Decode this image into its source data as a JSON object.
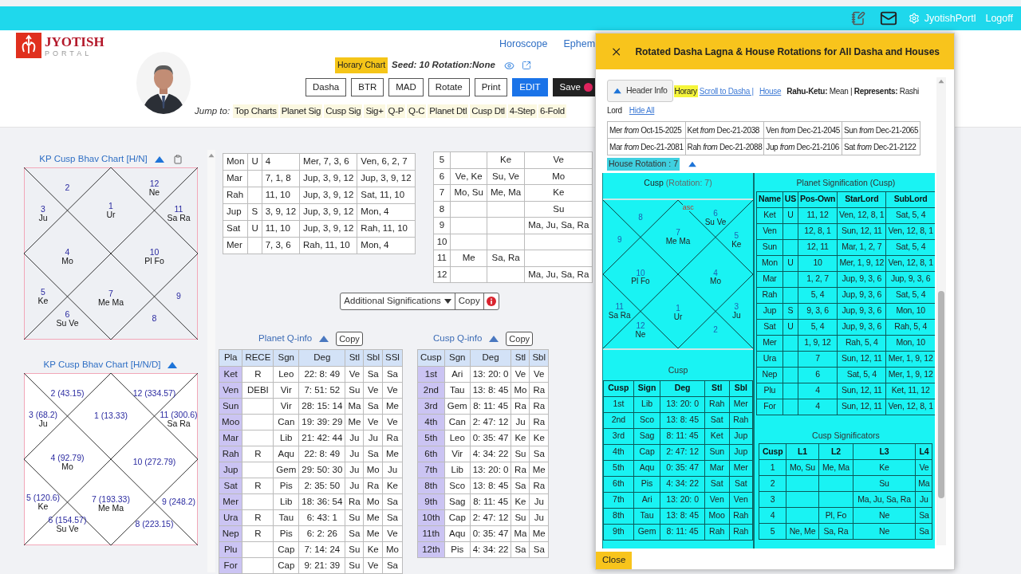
{
  "top_bar": {
    "user": "JyotishPortl",
    "logoff": "Logoff"
  },
  "logo": {
    "title": "JYOTISH",
    "subtitle": "PORTAL"
  },
  "nav": [
    "Horoscope",
    "Ephem"
  ],
  "chart_info": {
    "badge": "Horary Chart",
    "seed": "Seed: 10 Rotation:None"
  },
  "buttons": [
    {
      "label": "Dasha",
      "kind": "plain"
    },
    {
      "label": "BTR",
      "kind": "plain"
    },
    {
      "label": "MAD",
      "kind": "plain"
    },
    {
      "label": "Rotate",
      "kind": "plain"
    },
    {
      "label": "Print",
      "kind": "plain"
    },
    {
      "label": "EDIT",
      "kind": "primary"
    },
    {
      "label": "Save",
      "kind": "dark"
    }
  ],
  "jump": {
    "label": "Jump to:",
    "links": [
      "Top Charts",
      "Planet Sig",
      "Cusp Sig",
      "Sig+",
      "Q-P",
      "Q-C",
      "Planet Dtl",
      "Cusp Dtl",
      "4-Step",
      "6-Fold"
    ]
  },
  "charts": [
    {
      "title": "KP Cusp Bhav Chart [H/N]",
      "copy_icon": true,
      "shaded": true,
      "houses": [
        {
          "number": "1",
          "planets": "Ur"
        },
        {
          "number": "2"
        },
        {
          "number": "3",
          "planets": "Ju"
        },
        {
          "number": "4",
          "planets": "Mo"
        },
        {
          "number": "5",
          "planets": "Ke"
        },
        {
          "number": "6",
          "planets": "Su Ve"
        },
        {
          "number": "7",
          "planets": "Me Ma"
        },
        {
          "number": "8"
        },
        {
          "number": "9"
        },
        {
          "number": "10",
          "planets": "Pl Fo"
        },
        {
          "number": "11",
          "planets": "Sa Ra"
        },
        {
          "number": "12",
          "planets": "Ne"
        }
      ]
    },
    {
      "title": "KP Cusp Bhav Chart [H/N/D]",
      "copy_icon": false,
      "shaded": false,
      "houses": [
        {
          "number": "1 (13.33)"
        },
        {
          "number": "2 (43.15)"
        },
        {
          "number": "3 (68.2)",
          "planets": "Ju"
        },
        {
          "number": "4 (92.79)",
          "planets": "Mo"
        },
        {
          "number": "5 (120.6)",
          "planets": "Ke"
        },
        {
          "number": "6 (154.57)",
          "planets": "Su Ve"
        },
        {
          "number": "7 (193.33)",
          "planets": "Me Ma"
        },
        {
          "number": "8 (223.15)"
        },
        {
          "number": "9 (248.2)"
        },
        {
          "number": "10 (272.79)"
        },
        {
          "number": "11 (300.6)",
          "planets": "Sa Ra"
        },
        {
          "number": "12 (334.57)"
        }
      ]
    }
  ],
  "planet_table": {
    "rows": [
      [
        "Mon",
        "U",
        "4",
        "Mer, 7, 3, 6",
        "Ven, 6, 2, 7"
      ],
      [
        "Mar",
        null,
        "7, 1, 8",
        "Jup, 3, 9, 12",
        "Jup, 3, 9, 12"
      ],
      [
        "Rah",
        null,
        "11, 10",
        "Jup, 3, 9, 12",
        "Sat, 11, 10"
      ],
      [
        "Jup",
        "S",
        "3, 9, 12",
        "Jup, 3, 9, 12",
        "Mon, 4"
      ],
      [
        "Sat",
        "U",
        "11, 10",
        "Jup, 3, 9, 12",
        "Rah, 11, 10"
      ],
      [
        "Mer",
        null,
        "7, 3, 6",
        "Rah, 11, 10",
        "Mon, 4"
      ]
    ]
  },
  "cusp_table": {
    "rows": [
      [
        "5",
        null,
        "Ke",
        "Ve"
      ],
      [
        "6",
        "Ve, Ke",
        "Su, Ve",
        "Mo"
      ],
      [
        "7",
        "Mo, Su",
        "Me, Ma",
        "Ke"
      ],
      [
        "8",
        null,
        null,
        "Su"
      ],
      [
        "9",
        null,
        null,
        "Ma, Ju, Sa, Ra"
      ],
      [
        "10",
        null,
        null,
        null
      ],
      [
        "11",
        "Me",
        "Sa, Ra",
        null
      ],
      [
        "12",
        null,
        null,
        "Ma, Ju, Sa, Ra"
      ]
    ]
  },
  "additional": {
    "label": "Additional Significations",
    "copy": "Copy"
  },
  "planet_qinfo": {
    "title": "Planet Q-info",
    "copy": "Copy",
    "columns": [
      "Pla",
      "RECE",
      "Sgn",
      "Deg",
      "Stl",
      "Sbl",
      "SSl"
    ],
    "rows": [
      [
        "Ket",
        "R",
        "Leo",
        "22: 8: 49",
        "Ve",
        "Sa",
        "Sa"
      ],
      [
        "Ven",
        "DEBI",
        "Vir",
        "7: 51: 52",
        "Su",
        "Ve",
        "Ve"
      ],
      [
        "Sun",
        null,
        "Vir",
        "28: 15: 14",
        "Ma",
        "Sa",
        "Me"
      ],
      [
        "Moo",
        null,
        "Can",
        "19: 39: 29",
        "Me",
        "Ve",
        "Ve"
      ],
      [
        "Mar",
        null,
        "Lib",
        "21: 42: 44",
        "Ju",
        "Ju",
        "Ra"
      ],
      [
        "Rah",
        "R",
        "Aqu",
        "22: 8: 49",
        "Ju",
        "Sa",
        "Me"
      ],
      [
        "Jup",
        null,
        "Gem",
        "29: 50: 30",
        "Ju",
        "Mo",
        "Ju"
      ],
      [
        "Sat",
        "R",
        "Pis",
        "2: 35: 50",
        "Ju",
        "Ra",
        "Ke"
      ],
      [
        "Mer",
        null,
        "Lib",
        "18: 36: 54",
        "Ra",
        "Mo",
        "Sa"
      ],
      [
        "Ura",
        "R",
        "Tau",
        "6: 43: 1",
        "Su",
        "Me",
        "Sa"
      ],
      [
        "Nep",
        "R",
        "Pis",
        "6: 2: 26",
        "Sa",
        "Me",
        "Ve"
      ],
      [
        "Plu",
        null,
        "Cap",
        "7: 14: 24",
        "Su",
        "Ke",
        "Mo"
      ],
      [
        "For",
        null,
        "Cap",
        "9: 21: 39",
        "Su",
        "Ve",
        "Sa"
      ]
    ]
  },
  "cusp_qinfo": {
    "title": "Cusp Q-info",
    "copy": "Copy",
    "columns": [
      "Cusp",
      "Sgn",
      "Deg",
      "Stl",
      "Sbl"
    ],
    "rows": [
      [
        "1st",
        "Ari",
        "13: 20: 0",
        "Ve",
        "Ve"
      ],
      [
        "2nd",
        "Tau",
        "13: 8: 45",
        "Mo",
        "Ra"
      ],
      [
        "3rd",
        "Gem",
        "8: 11: 45",
        "Ra",
        "Ra"
      ],
      [
        "4th",
        "Can",
        "2: 47: 12",
        "Ju",
        "Ra"
      ],
      [
        "5th",
        "Leo",
        "0: 35: 47",
        "Ke",
        "Ke"
      ],
      [
        "6th",
        "Vir",
        "4: 34: 22",
        "Su",
        "Sa"
      ],
      [
        "7th",
        "Lib",
        "13: 20: 0",
        "Ra",
        "Me"
      ],
      [
        "8th",
        "Sco",
        "13: 8: 45",
        "Sa",
        "Ra"
      ],
      [
        "9th",
        "Sag",
        "8: 11: 45",
        "Ke",
        "Ju"
      ],
      [
        "10th",
        "Cap",
        "2: 47: 12",
        "Su",
        "Ju"
      ],
      [
        "11th",
        "Aqu",
        "0: 35: 47",
        "Ma",
        "Me"
      ],
      [
        "12th",
        "Pis",
        "4: 34: 22",
        "Sa",
        "Sa"
      ]
    ]
  },
  "modal": {
    "title": "Rotated Dasha Lagna & House Rotations for All Dasha and Houses",
    "header_info": "Header Info",
    "tag": "Horary",
    "links": [
      "Scroll to Dasha |",
      "House"
    ],
    "info_lines": [
      "**Rahu-Ketu:** Mean | **Represents:** Rashi",
      "Lord"
    ],
    "hide_all": "Hide All",
    "dasha": {
      "rows": [
        [
          "Mer *from* Oct-15-2025",
          "Ket *from* Dec-21-2038",
          "Ven *from* Dec-21-2045",
          "Sun *from* Dec-21-2065"
        ],
        [
          "Mar *from* Dec-21-2081",
          "Rah *from* Dec-21-2088",
          "Jup *from* Dec-21-2106",
          "Sat *from* Dec-21-2122"
        ]
      ]
    },
    "rotation_label": "House Rotation : 7",
    "cusp_title": "Cusp",
    "cusp_subtitle": "(Rotation: 7)",
    "chart": {
      "asc": "asc",
      "houses": [
        {
          "number": "7",
          "planets": "Me Ma"
        },
        {
          "number": "8"
        },
        {
          "number": "9"
        },
        {
          "number": "10",
          "planets": "Pl Fo"
        },
        {
          "number": "11",
          "planets": "Sa Ra"
        },
        {
          "number": "12",
          "planets": "Ne"
        },
        {
          "number": "1",
          "planets": "Ur"
        },
        {
          "number": "2"
        },
        {
          "number": "3",
          "planets": "Ju"
        },
        {
          "number": "4",
          "planets": "Mo"
        },
        {
          "number": "5",
          "planets": "Ke"
        },
        {
          "number": "6",
          "planets": "Su Ve"
        }
      ]
    },
    "cusp_caption": "Cusp",
    "cusp_table": {
      "columns": [
        "Cusp",
        "Sign",
        "Deg",
        "Stl",
        "Sbl"
      ],
      "rows": [
        [
          "1st",
          "Lib",
          "13: 20: 0",
          "Rah",
          "Mer"
        ],
        [
          "2nd",
          "Sco",
          "13: 8: 45",
          "Sat",
          "Rah"
        ],
        [
          "3rd",
          "Sag",
          "8: 11: 45",
          "Ket",
          "Jup"
        ],
        [
          "4th",
          "Cap",
          "2: 47: 12",
          "Sun",
          "Jup"
        ],
        [
          "5th",
          "Aqu",
          "0: 35: 47",
          "Mar",
          "Mer"
        ],
        [
          "6th",
          "Pis",
          "4: 34: 22",
          "Sat",
          "Sat"
        ],
        [
          "7th",
          "Ari",
          "13: 20: 0",
          "Ven",
          "Ven"
        ],
        [
          "8th",
          "Tau",
          "13: 8: 45",
          "Moo",
          "Rah"
        ],
        [
          "9th",
          "Gem",
          "8: 11: 45",
          "Rah",
          "Rah"
        ]
      ]
    },
    "planet_sig": {
      "title": "Planet Signification (Cusp)",
      "columns": [
        "Name",
        "US",
        "Pos-Own",
        "StarLord",
        "SubLord"
      ],
      "rows": [
        [
          "Ket",
          "U",
          "11, 12",
          "Ven, 12, 8, 1",
          "Sat, 5, 4"
        ],
        [
          "Ven",
          null,
          "12, 8, 1",
          "Sun, 12, 11",
          "Ven, 12, 8, 1"
        ],
        [
          "Sun",
          null,
          "12, 11",
          "Mar, 1, 2, 7",
          "Sat, 5, 4"
        ],
        [
          "Mon",
          "U",
          "10",
          "Mer, 1, 9, 12",
          "Ven, 12, 8, 1"
        ],
        [
          "Mar",
          null,
          "1, 2, 7",
          "Jup, 9, 3, 6",
          "Jup, 9, 3, 6"
        ],
        [
          "Rah",
          null,
          "5, 4",
          "Jup, 9, 3, 6",
          "Sat, 5, 4"
        ],
        [
          "Jup",
          "S",
          "9, 3, 6",
          "Jup, 9, 3, 6",
          "Mon, 10"
        ],
        [
          "Sat",
          "U",
          "5, 4",
          "Jup, 9, 3, 6",
          "Rah, 5, 4"
        ],
        [
          "Mer",
          null,
          "1, 9, 12",
          "Rah, 5, 4",
          "Mon, 10"
        ],
        [
          "Ura",
          null,
          "7",
          "Sun, 12, 11",
          "Mer, 1, 9, 12"
        ],
        [
          "Nep",
          null,
          "6",
          "Sat, 5, 4",
          "Mer, 1, 9, 12"
        ],
        [
          "Plu",
          null,
          "4",
          "Sun, 12, 11",
          "Ket, 11, 12"
        ],
        [
          "For",
          null,
          "4",
          "Sun, 12, 11",
          "Ven, 12, 8, 1"
        ]
      ]
    },
    "cusp_sig": {
      "title": "Cusp Significators",
      "columns": [
        "Cusp",
        "L1",
        "L2",
        "L3",
        "L4"
      ],
      "rows": [
        [
          "1",
          "Mo, Su",
          "Me, Ma",
          "Ke",
          "Ve"
        ],
        [
          "2",
          null,
          null,
          "Su",
          "Ma"
        ],
        [
          "3",
          null,
          null,
          "Ma, Ju, Sa, Ra",
          "Ju"
        ],
        [
          "4",
          null,
          "Pl, Fo",
          "Ne",
          "Sa"
        ],
        [
          "5",
          "Ne, Me",
          "Sa, Ra",
          "Ne",
          "Sa"
        ]
      ]
    },
    "close": "Close"
  }
}
